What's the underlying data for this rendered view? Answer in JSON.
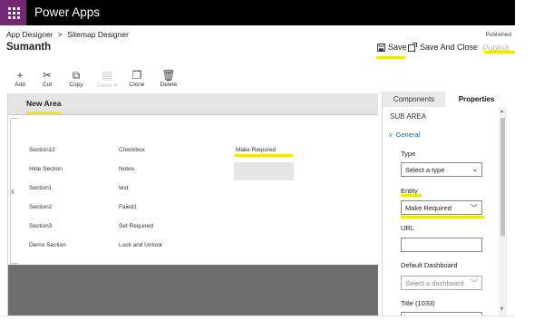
{
  "topbar": {
    "brand": "Power Apps"
  },
  "header": {
    "breadcrumb": [
      "App Designer",
      "Sitemap Designer"
    ],
    "breadcrumb_sep": ">",
    "site_name": "Sumanth",
    "status": "Published",
    "save_label": "Save",
    "save_close_label": "Save And Close",
    "publish_label": "Publish"
  },
  "toolbar": {
    "items": [
      {
        "label": "Add",
        "icon": "plus-icon",
        "glyph": "+"
      },
      {
        "label": "Cut",
        "icon": "cut-icon",
        "glyph": "✂"
      },
      {
        "label": "Copy",
        "icon": "copy-icon",
        "glyph": "⧉"
      },
      {
        "label": "Paste",
        "icon": "paste-icon",
        "glyph": "▤",
        "disabled": true
      },
      {
        "label": "Clone",
        "icon": "clone-icon",
        "glyph": "❐"
      },
      {
        "label": "Delete",
        "icon": "trash-icon",
        "glyph": "🗑"
      }
    ]
  },
  "area": {
    "title": "New Area",
    "rows": [
      {
        "group": "Section12",
        "sub": "Checkbox",
        "extra": "Make Required"
      },
      {
        "group": "Hide Section",
        "sub": "Notes",
        "extra": ""
      },
      {
        "group": "Section1",
        "sub": "test",
        "extra": ""
      },
      {
        "group": "Section2",
        "sub": "Faied1",
        "extra": ""
      },
      {
        "group": "Section3",
        "sub": "Set Required",
        "extra": ""
      },
      {
        "group": "Demo Section",
        "sub": "Lock and Unlock",
        "extra": ""
      }
    ]
  },
  "panel": {
    "tabs": [
      "Components",
      "Properties"
    ],
    "section_title": "SUB AREA",
    "group_label": "General",
    "fields": [
      {
        "label": "Type",
        "value": "Select a type",
        "kind": "select"
      },
      {
        "label": "Entity",
        "value": "Make Required",
        "kind": "dropdown"
      },
      {
        "label": "URL",
        "value": "",
        "kind": "text"
      },
      {
        "label": "Default Dashboard",
        "value": "Select a dashboard",
        "kind": "dropdown"
      },
      {
        "label": "Title (1033)",
        "value": "",
        "kind": "text"
      }
    ]
  },
  "colors": {
    "highlight": "#f5e600",
    "waffle": "#742774",
    "link": "#2266bb"
  }
}
